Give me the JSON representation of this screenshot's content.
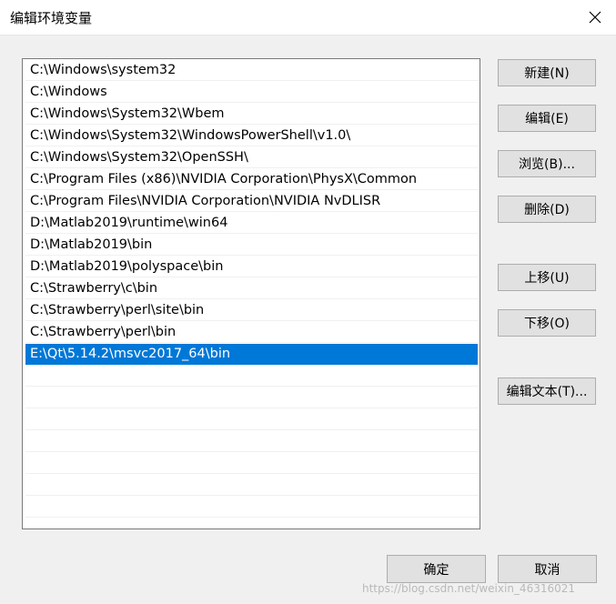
{
  "window": {
    "title": "编辑环境变量",
    "close_icon": "close-icon"
  },
  "path_list": {
    "items": [
      "C:\\Windows\\system32",
      "C:\\Windows",
      "C:\\Windows\\System32\\Wbem",
      "C:\\Windows\\System32\\WindowsPowerShell\\v1.0\\",
      "C:\\Windows\\System32\\OpenSSH\\",
      "C:\\Program Files (x86)\\NVIDIA Corporation\\PhysX\\Common",
      "C:\\Program Files\\NVIDIA Corporation\\NVIDIA NvDLISR",
      "D:\\Matlab2019\\runtime\\win64",
      "D:\\Matlab2019\\bin",
      "D:\\Matlab2019\\polyspace\\bin",
      "C:\\Strawberry\\c\\bin",
      "C:\\Strawberry\\perl\\site\\bin",
      "C:\\Strawberry\\perl\\bin",
      "E:\\Qt\\5.14.2\\msvc2017_64\\bin"
    ],
    "selected_index": 13,
    "selected_color": "#0078d7"
  },
  "buttons": {
    "new": "新建(N)",
    "edit": "编辑(E)",
    "browse": "浏览(B)...",
    "delete": "删除(D)",
    "move_up": "上移(U)",
    "move_down": "下移(O)",
    "edit_text": "编辑文本(T)..."
  },
  "footer": {
    "ok": "确定",
    "cancel": "取消"
  },
  "watermark": "https://blog.csdn.net/weixin_46316021"
}
